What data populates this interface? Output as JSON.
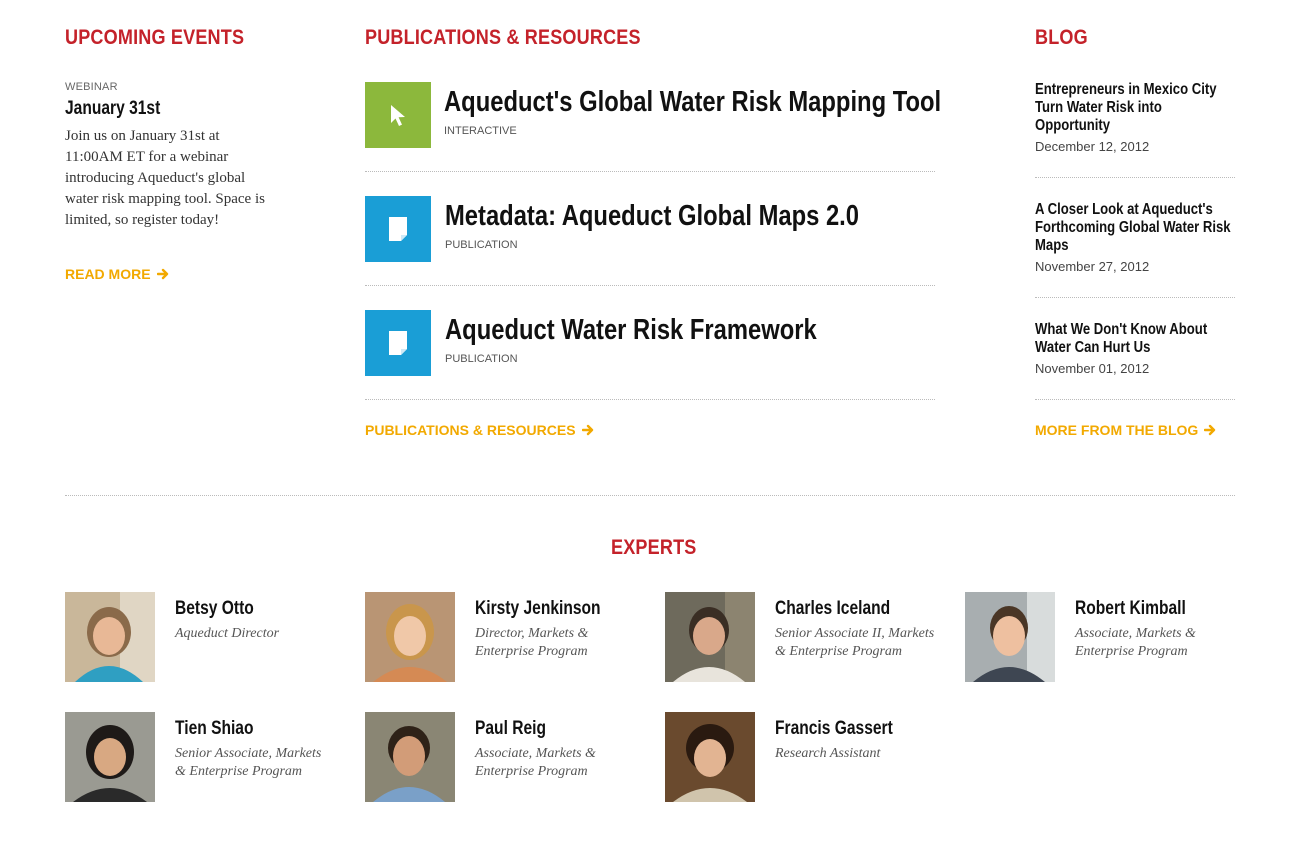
{
  "events": {
    "heading": "UPCOMING EVENTS",
    "type": "WEBINAR",
    "date": "January 31st",
    "description": "Join us on January 31st at 11:00AM ET for a webinar introducing Aqueduct's global water risk mapping tool. Space is limited, so register today!",
    "read_more": "READ MORE"
  },
  "publications": {
    "heading": "PUBLICATIONS & RESOURCES",
    "items": [
      {
        "title": "Aqueduct's Global Water Risk Mapping Tool",
        "type": "INTERACTIVE",
        "icon": "cursor-icon",
        "color": "#8cb83c"
      },
      {
        "title": "Metadata: Aqueduct Global Maps 2.0",
        "type": "PUBLICATION",
        "icon": "document-icon",
        "color": "#1a9ed6"
      },
      {
        "title": "Aqueduct Water Risk Framework",
        "type": "PUBLICATION",
        "icon": "document-icon",
        "color": "#1a9ed6"
      }
    ],
    "more_link": "PUBLICATIONS & RESOURCES"
  },
  "blog": {
    "heading": "BLOG",
    "posts": [
      {
        "title": "Entrepreneurs in Mexico City Turn Water Risk into Opportunity",
        "date": "December 12, 2012"
      },
      {
        "title": "A Closer Look at Aqueduct's Forthcoming Global Water Risk Maps",
        "date": "November 27, 2012"
      },
      {
        "title": "What We Don't Know About Water Can Hurt Us",
        "date": "November 01, 2012"
      }
    ],
    "more_link": "MORE FROM THE BLOG"
  },
  "experts": {
    "heading": "EXPERTS",
    "people": [
      {
        "name": "Betsy Otto",
        "role": "Aqueduct Director"
      },
      {
        "name": "Kirsty Jenkinson",
        "role": "Director, Markets & Enterprise Program"
      },
      {
        "name": "Charles Iceland",
        "role": "Senior Associate II, Markets & Enterprise Program"
      },
      {
        "name": "Robert Kimball",
        "role": "Associate, Markets & Enterprise Program"
      },
      {
        "name": "Tien Shiao",
        "role": "Senior Associate, Markets & Enterprise Program"
      },
      {
        "name": "Paul Reig",
        "role": "Associate, Markets & Enterprise Program"
      },
      {
        "name": "Francis Gassert",
        "role": "Research Assistant"
      }
    ]
  },
  "colors": {
    "heading_red": "#c4222a",
    "link_orange": "#f2a900",
    "interactive_green": "#8cb83c",
    "publication_blue": "#1a9ed6"
  }
}
